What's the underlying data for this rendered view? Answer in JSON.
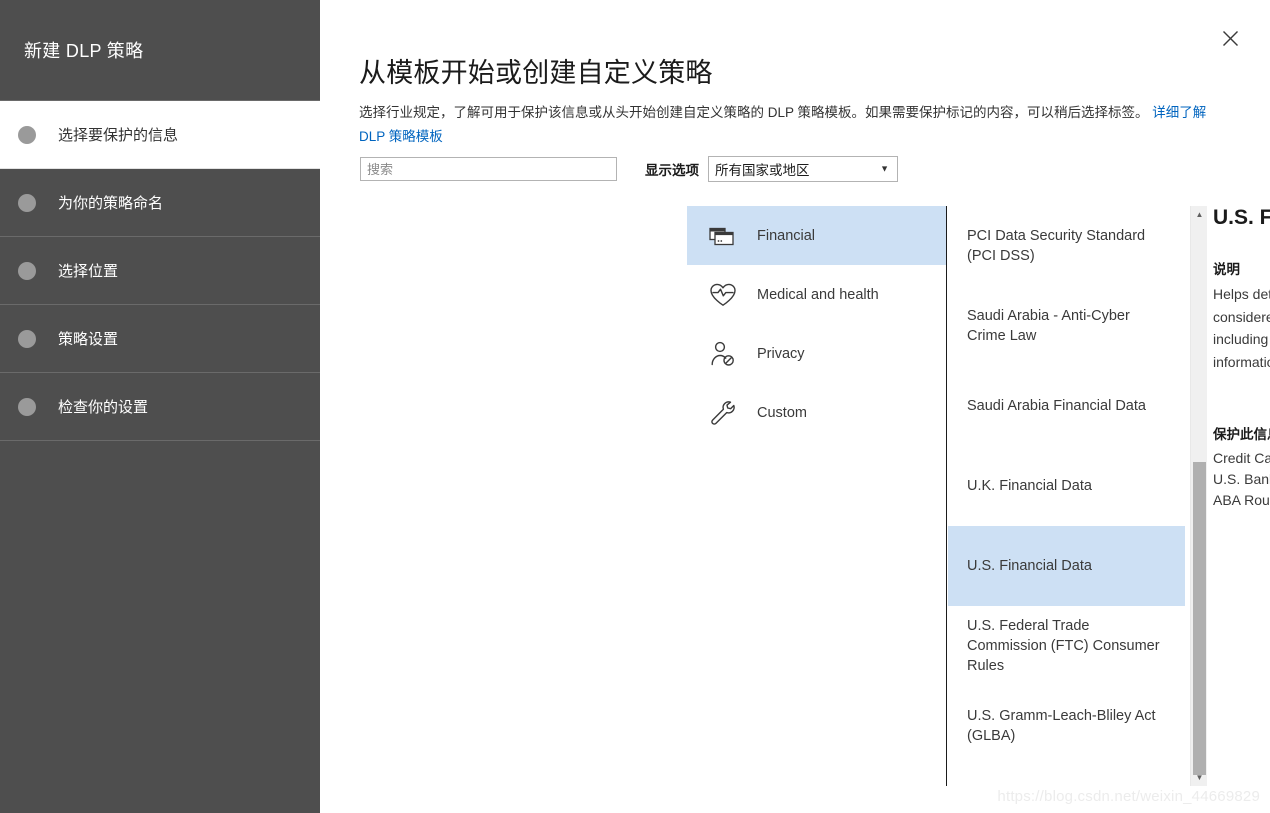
{
  "sidebar": {
    "title": "新建 DLP 策略",
    "steps": [
      {
        "label": "选择要保护的信息",
        "active": true
      },
      {
        "label": "为你的策略命名",
        "active": false
      },
      {
        "label": "选择位置",
        "active": false
      },
      {
        "label": "策略设置",
        "active": false
      },
      {
        "label": "检查你的设置",
        "active": false
      }
    ]
  },
  "main": {
    "title": "从模板开始或创建自定义策略",
    "description_part1": "选择行业规定，了解可用于保护该信息或从头开始创建自定义策略的 DLP 策略模板。如果需要保护标记的内容，可以稍后选择标签。",
    "description_link": "详细了解 DLP 策略模板",
    "close_icon": "close-icon"
  },
  "filters": {
    "search_placeholder": "搜索",
    "search_value": "",
    "display_options_label": "显示选项",
    "country_selected": "所有国家或地区",
    "country_options": [
      "所有国家或地区"
    ],
    "caret_icon": "chevron-down-icon"
  },
  "categories": [
    {
      "label": "Financial",
      "icon": "credit-card-icon",
      "selected": true
    },
    {
      "label": "Medical and health",
      "icon": "heart-pulse-icon",
      "selected": false
    },
    {
      "label": "Privacy",
      "icon": "person-blocked-icon",
      "selected": false
    },
    {
      "label": "Custom",
      "icon": "wrench-icon",
      "selected": false
    }
  ],
  "templates": [
    {
      "label": "PCI Data Security Standard (PCI DSS)",
      "selected": false
    },
    {
      "label": "Saudi Arabia - Anti-Cyber Crime Law",
      "selected": false
    },
    {
      "label": "Saudi Arabia Financial Data",
      "selected": false
    },
    {
      "label": "U.K. Financial Data",
      "selected": false
    },
    {
      "label": "U.S. Financial Data",
      "selected": true
    },
    {
      "label": "U.S. Federal Trade Commission (FTC) Consumer Rules",
      "selected": false
    },
    {
      "label": "U.S. Gramm-Leach-Bliley Act (GLBA)",
      "selected": false
    }
  ],
  "scrollbar": {
    "up_icon": "scroll-up-arrow-icon",
    "down_icon": "scroll-down-arrow-icon"
  },
  "detail": {
    "title": "U.S. Financial Data",
    "description_heading": "说明",
    "description": "Helps detect the presence of information commonly considered to be financial information in United States, including information like credit card, account information, and debit card numbers.",
    "protects_heading": "保护此信息:",
    "protects": [
      "Credit Card Number",
      "U.S. Bank Account Number",
      "ABA Routing Number"
    ]
  },
  "watermark": "https://blog.csdn.net/weixin_44669829",
  "colors": {
    "sidebar_bg": "#4e4e4e",
    "selection_blue": "#cde0f4",
    "link_blue": "#0064bf",
    "text_dark": "#1b1b1b"
  }
}
